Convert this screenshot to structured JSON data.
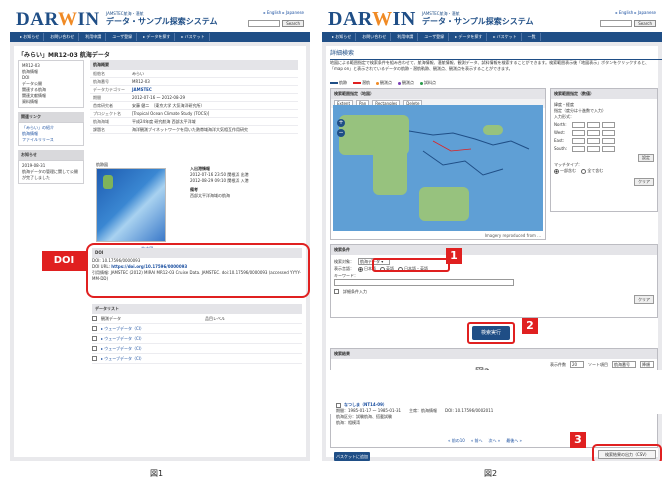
{
  "header": {
    "logo": "DARWIN",
    "org_line": "JAMSTEC航海・潜航",
    "subtitle": "データ・サンプル探索システム",
    "lang": "▸ English   ▸ Japanese",
    "search_btn": "Search"
  },
  "nav": {
    "items": [
      "▸ お知らせ",
      "お問い合わせ",
      "利用申請",
      "ユーザ登録",
      "▸ データを探す",
      "▸ バスケット",
      "一覧"
    ]
  },
  "fig1": {
    "title": "「みらい」MR12-03 航海データ",
    "left_items": [
      "MR12-03",
      "航海情報",
      "DOI",
      "データ公開",
      "関連する航海",
      "関連文献情報",
      "資料情報"
    ],
    "link_head": "関連リンク",
    "links": [
      "「みらい」の紹介",
      "航海情報",
      "ファイルリリース"
    ],
    "update_head": "お知らせ",
    "update_text": "2019-08-31\n航海データの管理に関して公開が完了しました",
    "sec_head": "航海概要",
    "rows": [
      {
        "k": "船舶名",
        "v": "みらい"
      },
      {
        "k": "航海番号",
        "v": "MR12-03"
      },
      {
        "k": "データカテゴリー",
        "v": "JAMSTEC"
      },
      {
        "k": "期間",
        "v": "2012-07-16 ～ 2012-08-29"
      },
      {
        "k": "首席研究者",
        "v": "安藤 健二　（東京大学 大気海洋研究所）"
      },
      {
        "k": "プロジェクト名",
        "v": "[Tropical Ocean Climate Study (TOCS)]"
      },
      {
        "k": "航海海域",
        "v": "平成24年度 研究航海 西部太平洋域"
      },
      {
        "k": "課題名",
        "v": "海洋観測ブイネットワークを用いた熱帯域海洋大気相互作用研究"
      }
    ],
    "track_label": "航跡図",
    "enlarge": "▸ 拡大図",
    "port_head": "入出港情報",
    "port_text": "2012-07-16 23:50 関根浜 出港\n2012-08-29 09:10 関根浜 入港",
    "remarks_head": "備考",
    "remarks_text": "西部太平洋海域の航海",
    "doi_head": "DOI",
    "doi_value": "DOI: 10.17596/0000093",
    "doi_url_label": "DOI URL:",
    "doi_url": "https://doi.org/10.17596/0000093",
    "doi_cite": "引用情報: JAMSTEC (2012) MIRAI MR12-03 Cruise Data. JAMSTEC. doi:10.17596/0000093 (accessed YYYY-MM-DD)",
    "doi_tag": "DOI",
    "data_head": "データリスト",
    "data_cols": [
      "観測データ",
      "品目レベル"
    ],
    "data_rows": [
      "▸ ウェーブデータ（CI）",
      "▸ ウェーブデータ（CI）",
      "▸ ウェーブデータ（CI）",
      "▸ ウェーブデータ（CI）"
    ]
  },
  "fig2": {
    "title": "詳細検索",
    "desc": "地図による範囲指定で検索条件を組み合わせて、航海情報、潜航情報、観測データ、試料情報を検索することができます。検索範囲表示後「地図表示」ボタンをクリックすると、「map on」と表示されているデータの航跡・潜航軌跡、観測点、観測点を表示することができます。",
    "legend": [
      "航跡",
      "潜航",
      "観測点",
      "観測点",
      "試料点"
    ],
    "map_head": "検索範囲指定（地図）",
    "tools": [
      "Extent",
      "Pan",
      "Rectangles",
      "Delete"
    ],
    "credit": "Imagery reproduced from ...",
    "coord_head": "検索範囲指定（数値）",
    "coord_note": "緯度・経度",
    "coord_hint": "指定（度分は十進数で入力）",
    "coord_input_label": "入力形式：",
    "coords": [
      "North:",
      "West:",
      "East:",
      "South:"
    ],
    "coord_set": "設定",
    "match_label": "マッチタイプ：",
    "match_opts": [
      "一部含む",
      "全て含む"
    ],
    "clear_btn": "クリア",
    "cond_head": "検索条件",
    "target_label": "検索対象：",
    "target_value": "航海データ ▾",
    "display_label": "表示言語：",
    "display_opts": [
      "日本語",
      "英語",
      "日本語・英語"
    ],
    "keyword_label": "キーワード：",
    "detail_label": "詳細条件入力",
    "exec_btn": "検索実行",
    "result_head": "検索結果",
    "per_page_label": "表示件数",
    "per_page": "20",
    "sort_label": "ソート項目",
    "sort_value": "航海番号",
    "order_value": "降順",
    "hits": "検索結果は100件を超えています",
    "fig_inner": "図2",
    "res_name": "なつしま（NT14-09）",
    "res_detail": "期間：1985-01-17 ～ 1985-01-31　　主席：航海情報　　DOI: 10.17596/0002011",
    "res_area": "航海区分：試験航海、搭載試験",
    "res_area2": "航海：相模湾",
    "pager": [
      "« 前の10",
      "« 前へ",
      "次へ »",
      "最後へ »"
    ],
    "basket_btn": "バスケットに追加",
    "csv_btn": "検索結果の出力（CSV）"
  },
  "tags": [
    "1",
    "2",
    "3"
  ],
  "captions": [
    "図1",
    "図2"
  ],
  "colors": {
    "brand": "#1f4e86",
    "accent": "#e02020",
    "logo_o": "#f08a24"
  }
}
